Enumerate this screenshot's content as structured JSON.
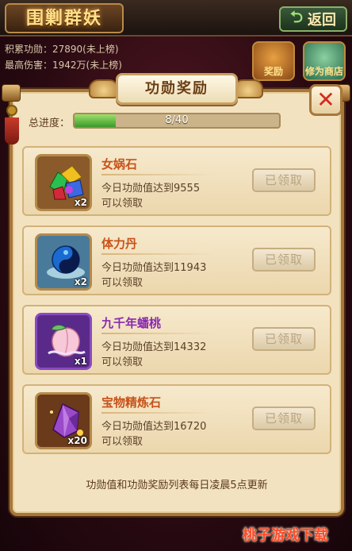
{
  "header": {
    "title": "围剿群妖",
    "back_label": "返回",
    "stats": [
      "积累功勋：27890(未上榜)",
      "最高伤害：1942万(未上榜)"
    ],
    "side_buttons": [
      "奖励",
      "修为商店"
    ]
  },
  "dialog": {
    "title": "功勋奖励",
    "progress": {
      "label": "总进度：",
      "current": 8,
      "total": 40,
      "text": "8/40"
    },
    "rewards": [
      {
        "name": "女娲石",
        "count": "x2",
        "desc1": "今日功勋值达到9555",
        "desc2": "可以领取",
        "button": "已领取",
        "icon": "gem-cluster-icon"
      },
      {
        "name": "体力丹",
        "count": "x2",
        "desc1": "今日功勋值达到11943",
        "desc2": "可以领取",
        "button": "已领取",
        "icon": "stamina-pill-icon"
      },
      {
        "name": "九千年蟠桃",
        "count": "x1",
        "desc1": "今日功勋值达到14332",
        "desc2": "可以领取",
        "button": "已领取",
        "icon": "peach-icon"
      },
      {
        "name": "宝物精炼石",
        "count": "x20",
        "desc1": "今日功勋值达到16720",
        "desc2": "可以领取",
        "button": "已领取",
        "icon": "refine-crystal-icon"
      }
    ],
    "footer": "功勋值和功勋奖励列表每日凌晨5点更新"
  },
  "watermark": "桃子游戏下载",
  "colors": {
    "panel": "#f3e2bf",
    "border": "#a8773c",
    "progress_fill": "#3a9a2a",
    "item_name": "#c8521a",
    "item_name_epic": "#8a2ab0",
    "close": "#d42a1e"
  }
}
